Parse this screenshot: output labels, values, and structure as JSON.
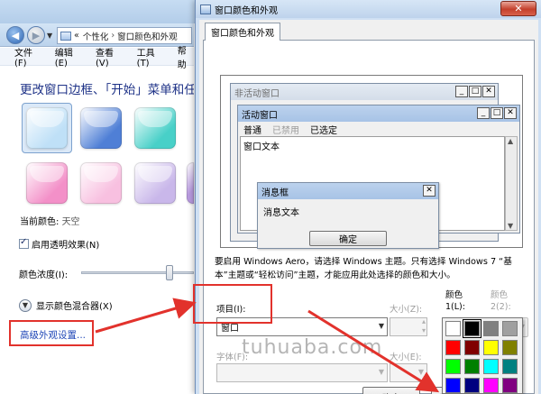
{
  "control_panel": {
    "breadcrumb": [
      "«",
      "个性化",
      "窗口颜色和外观"
    ],
    "breadcrumb_sep": "›",
    "menu": [
      "文件(F)",
      "编辑(E)",
      "查看(V)",
      "工具(T)",
      "帮助"
    ],
    "heading": "更改窗口边框、「开始」菜单和任务栏的颜色",
    "swatch_colors": [
      "#bfe0f7",
      "#4f7fd6",
      "#48d0c8",
      "#f390c8",
      "#f8c0e0",
      "#c9b7ea",
      "#b99be0"
    ],
    "current_color_label": "当前颜色:",
    "current_color_value": "天空",
    "transparency_label": "启用透明效果(N)",
    "transparency_checked": true,
    "intensity_label": "颜色浓度(I):",
    "intensity_level": 0.78,
    "mixer_label": "显示颜色混合器(X)",
    "advanced_link": "高级外观设置..."
  },
  "dialog": {
    "title": "窗口颜色和外观",
    "close_label": "✕",
    "tab_label": "窗口颜色和外观",
    "preview": {
      "inactive_title": "非活动窗口",
      "active_title": "活动窗口",
      "menu_normal": "普通",
      "menu_disabled": "已禁用",
      "menu_selected": "已选定",
      "window_text": "窗口文本",
      "msgbox_title": "消息框",
      "msgbox_text": "消息文本",
      "ok_label": "确定",
      "win_min": "_",
      "win_max": "□",
      "win_close": "✕"
    },
    "description": "要启用 Windows Aero，请选择 Windows 主题。只有选择 Windows 7 “基本”主题或“轻松访问”主题，才能应用此处选择的颜色和大小。",
    "item_label": "项目(I):",
    "item_value": "窗口",
    "size_label_1": "大小(Z):",
    "color1_label": "颜色\n1(L):",
    "color2_label": "颜色\n2(2):",
    "font_label": "字体(F):",
    "size_label_2": "大小(E):",
    "font_color_label": "颜色",
    "ok_bottom": "确定",
    "cancel_bottom": "取"
  },
  "palette": {
    "colors": [
      [
        "#ffffff",
        "#000000",
        "#808080",
        "#a0a0a0"
      ],
      [
        "#ff0000",
        "#800000",
        "#ffff00",
        "#808000"
      ],
      [
        "#00ff00",
        "#008000",
        "#00ffff",
        "#008080"
      ],
      [
        "#0000ff",
        "#000080",
        "#ff00ff",
        "#800080"
      ]
    ]
  },
  "watermark": "tuhuaba.com",
  "annotation_color": "#e2322c"
}
